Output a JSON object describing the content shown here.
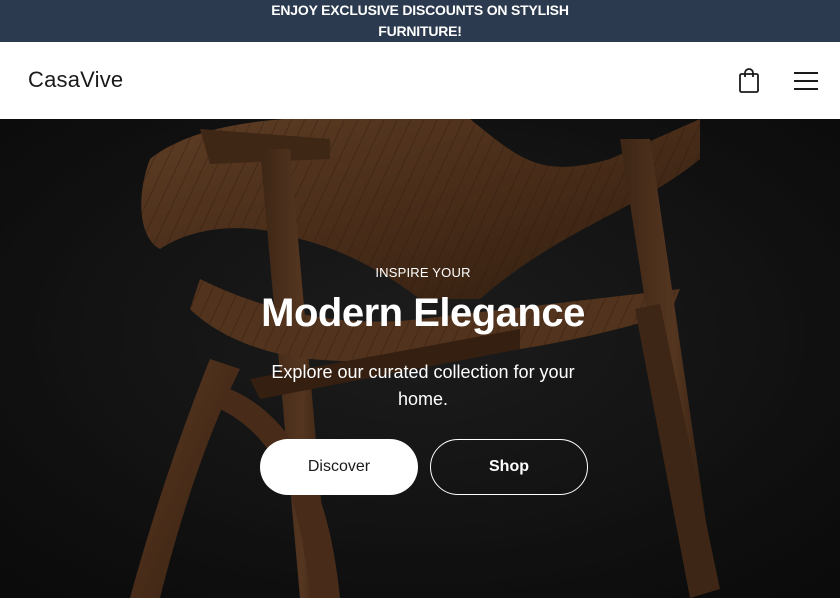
{
  "announcement": {
    "text": "ENJOY EXCLUSIVE DISCOUNTS ON STYLISH FURNITURE!"
  },
  "header": {
    "logo": "CasaVive",
    "cart_icon": "shopping-bag-icon",
    "menu_icon": "hamburger-menu-icon"
  },
  "hero": {
    "eyebrow": "INSPIRE YOUR",
    "headline": "Modern Elegance",
    "subtext": "Explore our curated collection for your home.",
    "primary_button": "Discover",
    "secondary_button": "Shop"
  },
  "colors": {
    "announcement_bg": "#2b3a4e",
    "header_bg": "#ffffff",
    "hero_bg": "#1a1a1a",
    "text_light": "#ffffff",
    "text_dark": "#1a1a1a"
  }
}
